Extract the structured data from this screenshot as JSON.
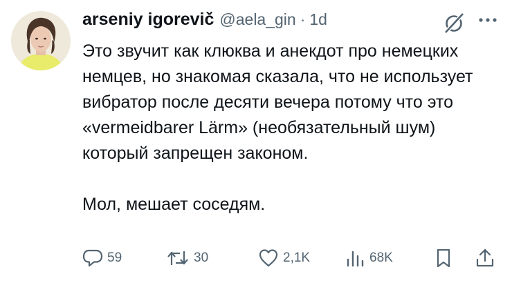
{
  "author": {
    "display_name": "arseniy igorevič",
    "handle": "@aela_gin",
    "separator": "·",
    "time": "1d",
    "avatar_icon": "profile-photo"
  },
  "post": {
    "paragraphs": [
      "Это звучит как клюква и анекдот про немецких немцев, но знакомая сказала, что не использует вибратор после десяти вечера потому что это «vermeidbarer Lärm» (необязательный шум) который запрещен законом.",
      "Мол, мешает соседям."
    ]
  },
  "actions": {
    "reply_count": "59",
    "retweet_count": "30",
    "like_count": "2,1K",
    "views_count": "68K"
  },
  "icons": {
    "grok": "grok-icon",
    "more": "more-icon",
    "reply": "reply-icon",
    "retweet": "retweet-icon",
    "like": "heart-icon",
    "views": "views-icon",
    "bookmark": "bookmark-icon",
    "share": "share-icon"
  },
  "colors": {
    "text_primary": "#0f1419",
    "text_secondary": "#536471",
    "background": "#ffffff"
  }
}
